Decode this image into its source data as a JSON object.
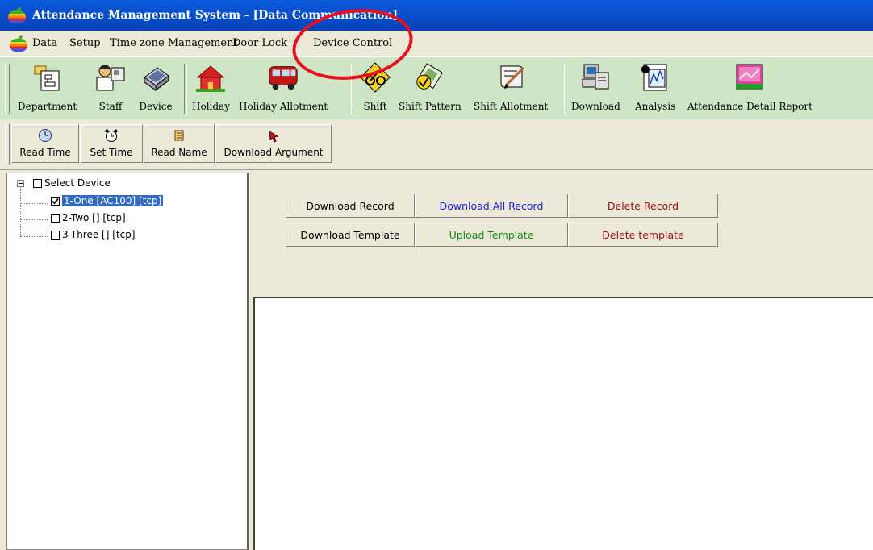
{
  "window": {
    "title": "Attendance Management System - [Data Communication]"
  },
  "menu": {
    "items": [
      "Data",
      "Setup",
      "Time zone Management",
      "Door Lock",
      "Device Control"
    ]
  },
  "toolbar": {
    "buttons": [
      {
        "label": "Department",
        "icon": "department-icon"
      },
      {
        "label": "Staff",
        "icon": "staff-icon"
      },
      {
        "label": "Device",
        "icon": "device-icon"
      },
      {
        "label": "Holiday",
        "icon": "holiday-icon"
      },
      {
        "label": "Holiday Allotment",
        "icon": "bus-icon"
      },
      {
        "label": "Shift",
        "icon": "shift-icon"
      },
      {
        "label": "Shift Pattern",
        "icon": "shift-pattern-icon"
      },
      {
        "label": "Shift Allotment",
        "icon": "shift-allotment-icon"
      },
      {
        "label": "Download",
        "icon": "download-icon"
      },
      {
        "label": "Analysis",
        "icon": "analysis-icon"
      },
      {
        "label": "Attendance Detail Report",
        "icon": "report-icon"
      }
    ]
  },
  "subtoolbar": {
    "buttons": [
      {
        "label": "Read Time",
        "icon": "clock-icon"
      },
      {
        "label": "Set Time",
        "icon": "alarm-clock-icon"
      },
      {
        "label": "Read Name",
        "icon": "read-name-icon"
      },
      {
        "label": "Download Argument",
        "icon": "download-argument-icon"
      }
    ]
  },
  "tree": {
    "root": {
      "label": "Select Device",
      "checked": false,
      "expanded": true
    },
    "devices": [
      {
        "label": "1-One  [AC100]  [tcp]",
        "checked": true,
        "selected": true
      },
      {
        "label": "2-Two  []  [tcp]",
        "checked": false,
        "selected": false
      },
      {
        "label": "3-Three  []  [tcp]",
        "checked": false,
        "selected": false
      }
    ]
  },
  "actions": {
    "download_record": "Download Record",
    "download_all_record": "Download All Record",
    "delete_record": "Delete Record",
    "download_template": "Download Template",
    "upload_template": "Upload Template",
    "delete_template": "Delete template"
  },
  "colors": {
    "title_bar": "#0a5adc",
    "toolbar_bg": "#cee6c6",
    "selection": "#316ac5",
    "download_all_text": "#1a1aee",
    "upload_template_text": "#138a13",
    "delete_text": "#a01010",
    "highlight_circle": "#e8101a"
  }
}
